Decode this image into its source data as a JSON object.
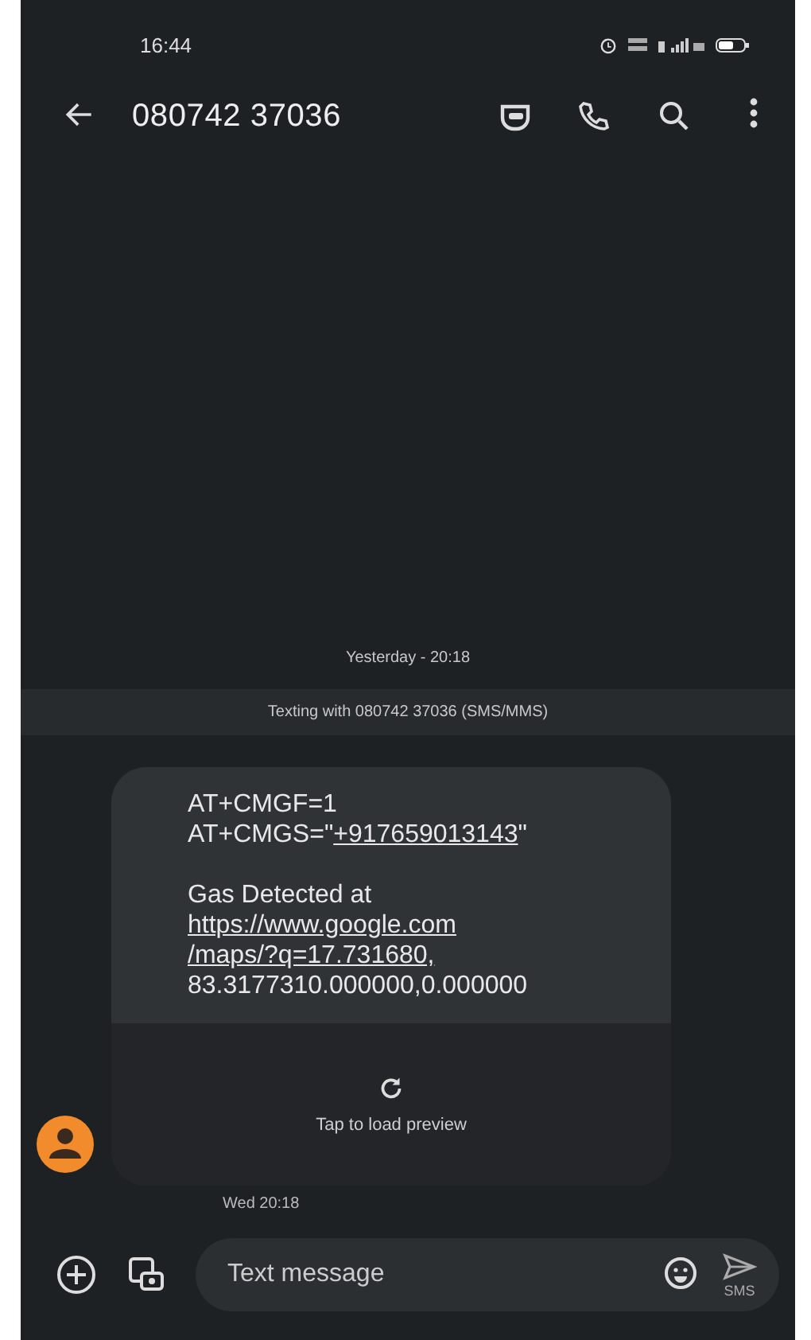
{
  "status_bar": {
    "time": "16:44"
  },
  "header": {
    "title": "080742 37036"
  },
  "date_divider": "Yesterday - 20:18",
  "texting_banner": "Texting with 080742 37036 (SMS/MMS)",
  "message": {
    "paragraphs": [
      [
        [
          {
            "kind": "text",
            "text": "AT+CMGF=1"
          }
        ],
        [
          {
            "kind": "text",
            "text": "AT+CMGS=\""
          },
          {
            "kind": "link",
            "text": "+917659013143"
          },
          {
            "kind": "text",
            "text": "\""
          }
        ]
      ],
      [
        [
          {
            "kind": "text",
            "text": "Gas Detected at"
          }
        ],
        [
          {
            "kind": "link",
            "text": "https://www.google.com"
          }
        ],
        [
          {
            "kind": "link",
            "text": "/maps/?q=17.731680,"
          }
        ],
        [
          {
            "kind": "text",
            "text": "83.3177310.000000,0.000000"
          }
        ]
      ]
    ],
    "preview_label": "Tap to load preview",
    "time": "Wed 20:18"
  },
  "composer": {
    "placeholder": "Text message",
    "send_label": "SMS"
  }
}
